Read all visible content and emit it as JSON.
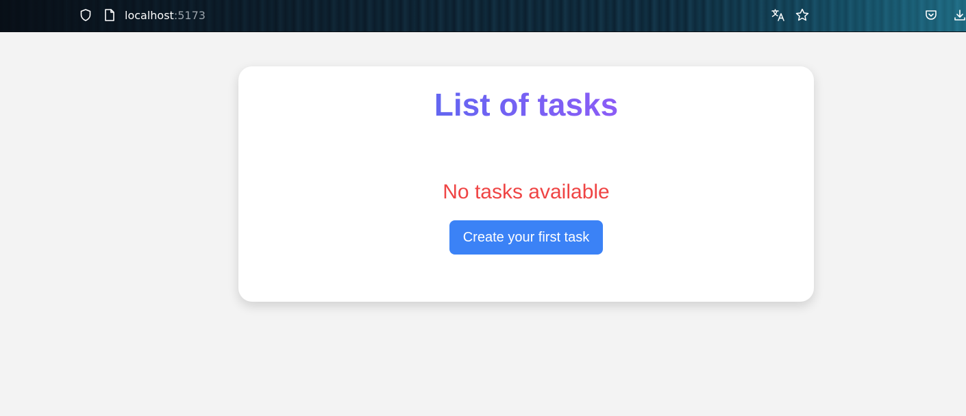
{
  "browser": {
    "url_host": "localhost",
    "url_port": ":5173",
    "icons": [
      "shield-icon",
      "page-icon",
      "translate-icon",
      "star-icon",
      "pocket-icon",
      "download-icon"
    ]
  },
  "main": {
    "title": "List of tasks",
    "empty_message": "No tasks available",
    "create_button_label": "Create your first task"
  },
  "colors": {
    "title_gradient_start": "#6366f1",
    "title_gradient_end": "#8b5cf6",
    "empty_message": "#ef4444",
    "button_background": "#3b82f6",
    "page_background": "#f3f3f3",
    "card_background": "#ffffff"
  }
}
